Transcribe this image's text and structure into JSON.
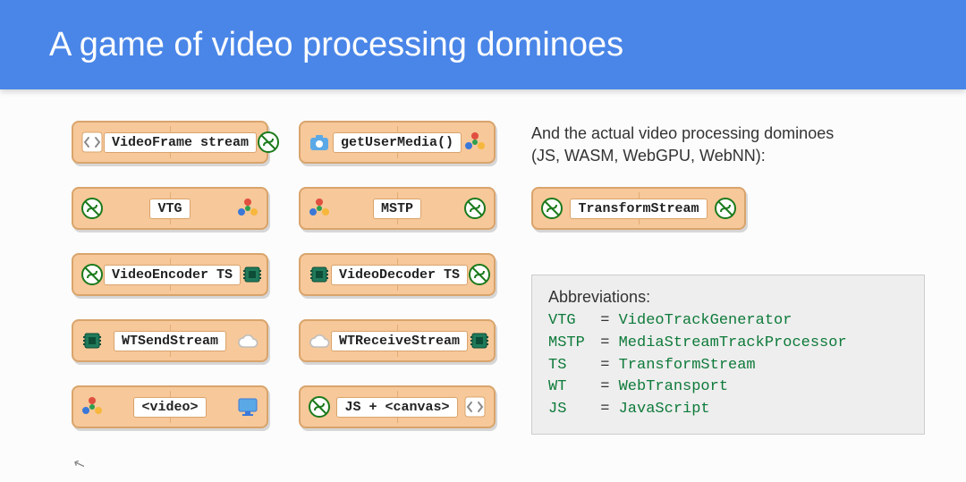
{
  "header": {
    "title": "A game of video processing dominoes"
  },
  "dominoes": [
    {
      "left_icon": "code",
      "label": "VideoFrame stream",
      "right_icon": "streams"
    },
    {
      "left_icon": "camera",
      "label": "getUserMedia()",
      "right_icon": "webrtc"
    },
    {
      "left_icon": "streams",
      "label": "VTG",
      "right_icon": "webrtc"
    },
    {
      "left_icon": "webrtc",
      "label": "MSTP",
      "right_icon": "streams"
    },
    {
      "left_icon": "streams",
      "label": "VideoEncoder TS",
      "right_icon": "chip"
    },
    {
      "left_icon": "chip",
      "label": "VideoDecoder TS",
      "right_icon": "streams"
    },
    {
      "left_icon": "chip",
      "label": "WTSendStream",
      "right_icon": "cloud"
    },
    {
      "left_icon": "cloud",
      "label": "WTReceiveStream",
      "right_icon": "chip"
    },
    {
      "left_icon": "webrtc",
      "label": "<video>",
      "right_icon": "monitor"
    },
    {
      "left_icon": "streams",
      "label": "JS + <canvas>",
      "right_icon": "code"
    }
  ],
  "right": {
    "subtitle_line1": "And the actual video processing dominoes",
    "subtitle_line2": "(JS, WASM, WebGPU, WebNN):",
    "transform_domino": {
      "left_icon": "streams",
      "label": "TransformStream",
      "right_icon": "streams"
    },
    "abbrev_title": "Abbreviations:",
    "abbrevs": [
      {
        "key": "VTG",
        "val": "VideoTrackGenerator"
      },
      {
        "key": "MSTP",
        "val": "MediaStreamTrackProcessor"
      },
      {
        "key": "TS",
        "val": "TransformStream"
      },
      {
        "key": "WT",
        "val": "WebTransport"
      },
      {
        "key": "JS",
        "val": "JavaScript"
      }
    ]
  }
}
